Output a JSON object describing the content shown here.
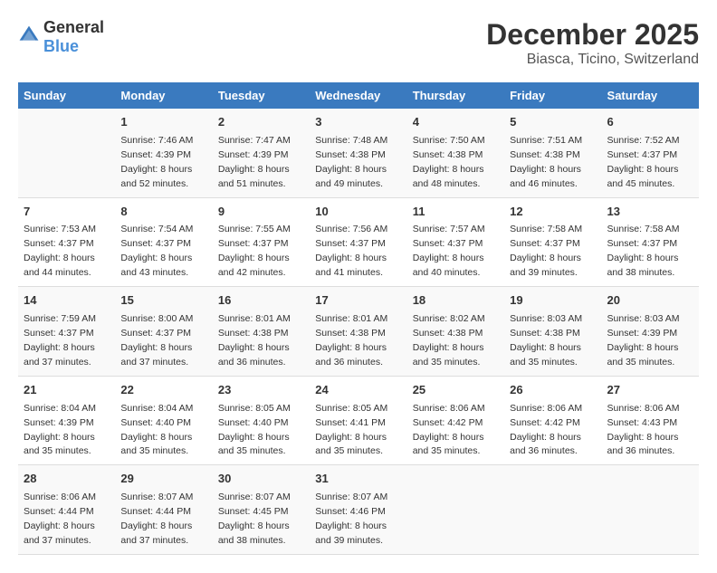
{
  "header": {
    "logo_general": "General",
    "logo_blue": "Blue",
    "title": "December 2025",
    "subtitle": "Biasca, Ticino, Switzerland"
  },
  "days_of_week": [
    "Sunday",
    "Monday",
    "Tuesday",
    "Wednesday",
    "Thursday",
    "Friday",
    "Saturday"
  ],
  "weeks": [
    [
      {
        "day": "",
        "sunrise": "",
        "sunset": "",
        "daylight": ""
      },
      {
        "day": "1",
        "sunrise": "Sunrise: 7:46 AM",
        "sunset": "Sunset: 4:39 PM",
        "daylight": "Daylight: 8 hours and 52 minutes."
      },
      {
        "day": "2",
        "sunrise": "Sunrise: 7:47 AM",
        "sunset": "Sunset: 4:39 PM",
        "daylight": "Daylight: 8 hours and 51 minutes."
      },
      {
        "day": "3",
        "sunrise": "Sunrise: 7:48 AM",
        "sunset": "Sunset: 4:38 PM",
        "daylight": "Daylight: 8 hours and 49 minutes."
      },
      {
        "day": "4",
        "sunrise": "Sunrise: 7:50 AM",
        "sunset": "Sunset: 4:38 PM",
        "daylight": "Daylight: 8 hours and 48 minutes."
      },
      {
        "day": "5",
        "sunrise": "Sunrise: 7:51 AM",
        "sunset": "Sunset: 4:38 PM",
        "daylight": "Daylight: 8 hours and 46 minutes."
      },
      {
        "day": "6",
        "sunrise": "Sunrise: 7:52 AM",
        "sunset": "Sunset: 4:37 PM",
        "daylight": "Daylight: 8 hours and 45 minutes."
      }
    ],
    [
      {
        "day": "7",
        "sunrise": "Sunrise: 7:53 AM",
        "sunset": "Sunset: 4:37 PM",
        "daylight": "Daylight: 8 hours and 44 minutes."
      },
      {
        "day": "8",
        "sunrise": "Sunrise: 7:54 AM",
        "sunset": "Sunset: 4:37 PM",
        "daylight": "Daylight: 8 hours and 43 minutes."
      },
      {
        "day": "9",
        "sunrise": "Sunrise: 7:55 AM",
        "sunset": "Sunset: 4:37 PM",
        "daylight": "Daylight: 8 hours and 42 minutes."
      },
      {
        "day": "10",
        "sunrise": "Sunrise: 7:56 AM",
        "sunset": "Sunset: 4:37 PM",
        "daylight": "Daylight: 8 hours and 41 minutes."
      },
      {
        "day": "11",
        "sunrise": "Sunrise: 7:57 AM",
        "sunset": "Sunset: 4:37 PM",
        "daylight": "Daylight: 8 hours and 40 minutes."
      },
      {
        "day": "12",
        "sunrise": "Sunrise: 7:58 AM",
        "sunset": "Sunset: 4:37 PM",
        "daylight": "Daylight: 8 hours and 39 minutes."
      },
      {
        "day": "13",
        "sunrise": "Sunrise: 7:58 AM",
        "sunset": "Sunset: 4:37 PM",
        "daylight": "Daylight: 8 hours and 38 minutes."
      }
    ],
    [
      {
        "day": "14",
        "sunrise": "Sunrise: 7:59 AM",
        "sunset": "Sunset: 4:37 PM",
        "daylight": "Daylight: 8 hours and 37 minutes."
      },
      {
        "day": "15",
        "sunrise": "Sunrise: 8:00 AM",
        "sunset": "Sunset: 4:37 PM",
        "daylight": "Daylight: 8 hours and 37 minutes."
      },
      {
        "day": "16",
        "sunrise": "Sunrise: 8:01 AM",
        "sunset": "Sunset: 4:38 PM",
        "daylight": "Daylight: 8 hours and 36 minutes."
      },
      {
        "day": "17",
        "sunrise": "Sunrise: 8:01 AM",
        "sunset": "Sunset: 4:38 PM",
        "daylight": "Daylight: 8 hours and 36 minutes."
      },
      {
        "day": "18",
        "sunrise": "Sunrise: 8:02 AM",
        "sunset": "Sunset: 4:38 PM",
        "daylight": "Daylight: 8 hours and 35 minutes."
      },
      {
        "day": "19",
        "sunrise": "Sunrise: 8:03 AM",
        "sunset": "Sunset: 4:38 PM",
        "daylight": "Daylight: 8 hours and 35 minutes."
      },
      {
        "day": "20",
        "sunrise": "Sunrise: 8:03 AM",
        "sunset": "Sunset: 4:39 PM",
        "daylight": "Daylight: 8 hours and 35 minutes."
      }
    ],
    [
      {
        "day": "21",
        "sunrise": "Sunrise: 8:04 AM",
        "sunset": "Sunset: 4:39 PM",
        "daylight": "Daylight: 8 hours and 35 minutes."
      },
      {
        "day": "22",
        "sunrise": "Sunrise: 8:04 AM",
        "sunset": "Sunset: 4:40 PM",
        "daylight": "Daylight: 8 hours and 35 minutes."
      },
      {
        "day": "23",
        "sunrise": "Sunrise: 8:05 AM",
        "sunset": "Sunset: 4:40 PM",
        "daylight": "Daylight: 8 hours and 35 minutes."
      },
      {
        "day": "24",
        "sunrise": "Sunrise: 8:05 AM",
        "sunset": "Sunset: 4:41 PM",
        "daylight": "Daylight: 8 hours and 35 minutes."
      },
      {
        "day": "25",
        "sunrise": "Sunrise: 8:06 AM",
        "sunset": "Sunset: 4:42 PM",
        "daylight": "Daylight: 8 hours and 35 minutes."
      },
      {
        "day": "26",
        "sunrise": "Sunrise: 8:06 AM",
        "sunset": "Sunset: 4:42 PM",
        "daylight": "Daylight: 8 hours and 36 minutes."
      },
      {
        "day": "27",
        "sunrise": "Sunrise: 8:06 AM",
        "sunset": "Sunset: 4:43 PM",
        "daylight": "Daylight: 8 hours and 36 minutes."
      }
    ],
    [
      {
        "day": "28",
        "sunrise": "Sunrise: 8:06 AM",
        "sunset": "Sunset: 4:44 PM",
        "daylight": "Daylight: 8 hours and 37 minutes."
      },
      {
        "day": "29",
        "sunrise": "Sunrise: 8:07 AM",
        "sunset": "Sunset: 4:44 PM",
        "daylight": "Daylight: 8 hours and 37 minutes."
      },
      {
        "day": "30",
        "sunrise": "Sunrise: 8:07 AM",
        "sunset": "Sunset: 4:45 PM",
        "daylight": "Daylight: 8 hours and 38 minutes."
      },
      {
        "day": "31",
        "sunrise": "Sunrise: 8:07 AM",
        "sunset": "Sunset: 4:46 PM",
        "daylight": "Daylight: 8 hours and 39 minutes."
      },
      {
        "day": "",
        "sunrise": "",
        "sunset": "",
        "daylight": ""
      },
      {
        "day": "",
        "sunrise": "",
        "sunset": "",
        "daylight": ""
      },
      {
        "day": "",
        "sunrise": "",
        "sunset": "",
        "daylight": ""
      }
    ]
  ]
}
